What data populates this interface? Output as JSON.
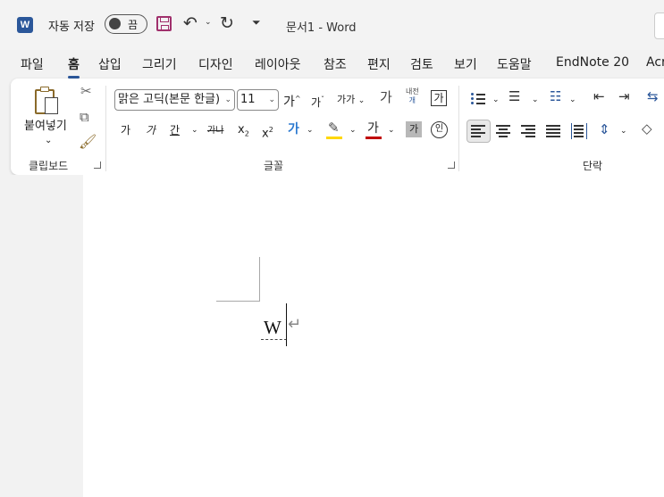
{
  "titlebar": {
    "app_icon_letter": "W",
    "autosave_label": "자동 저장",
    "autosave_state": "끔",
    "document_title": "문서1  -  Word"
  },
  "tabs": [
    {
      "label": "파일"
    },
    {
      "label": "홈"
    },
    {
      "label": "삽입"
    },
    {
      "label": "그리기"
    },
    {
      "label": "디자인"
    },
    {
      "label": "레이아웃"
    },
    {
      "label": "참조"
    },
    {
      "label": "편지"
    },
    {
      "label": "검토"
    },
    {
      "label": "보기"
    },
    {
      "label": "도움말"
    },
    {
      "label": "EndNote 20"
    },
    {
      "label": "Acr"
    }
  ],
  "ribbon": {
    "clipboard": {
      "paste_label": "붙여넣기",
      "group_label": "클립보드"
    },
    "font": {
      "font_name": "맑은 고딕(본문 한글)",
      "font_size": "11",
      "grow_label": "가",
      "shrink_label": "가",
      "case_label": "가가",
      "phonetic_top": "내전",
      "phonetic_bottom": "개",
      "char_border_label": "가",
      "bold_label": "가",
      "italic_label": "가",
      "underline_label": "간",
      "strike_label": "가나",
      "sub_label": "x",
      "sub_index": "2",
      "sup_label": "x",
      "sup_index": "2",
      "effects_label": "가",
      "font_color_label": "가",
      "shading_label": "가",
      "enclose_label": "인",
      "group_label": "글꼴"
    },
    "paragraph": {
      "group_label": "단락"
    }
  },
  "document": {
    "text": "W"
  },
  "colors": {
    "accent": "#2b579a",
    "font_color": "#c00000",
    "highlight": "#ffd700",
    "save_icon": "#a0306c"
  }
}
